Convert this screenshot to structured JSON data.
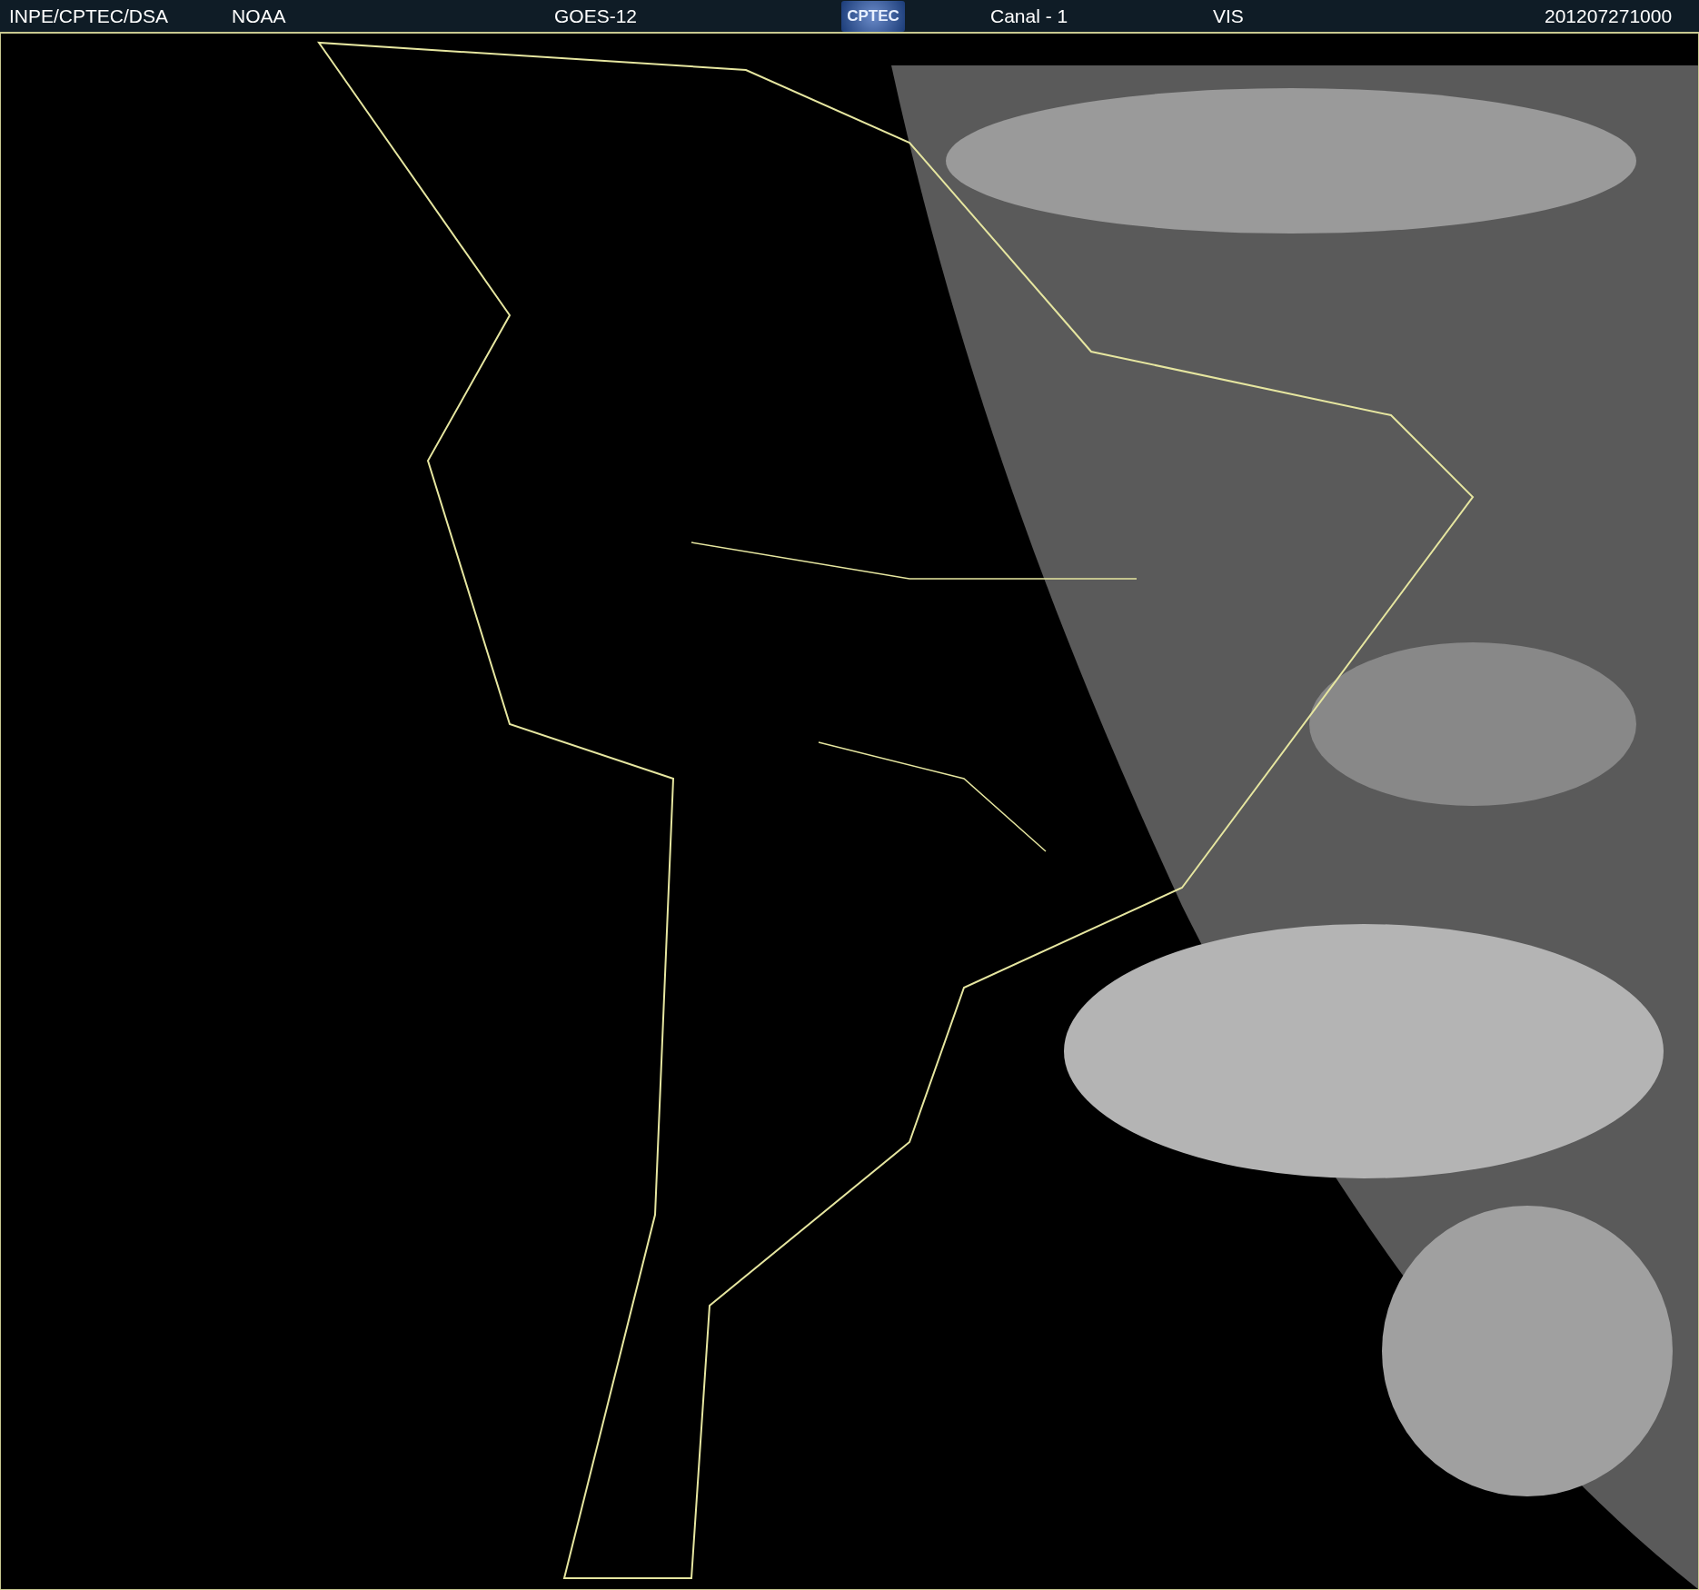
{
  "header": {
    "items": [
      "INPE/CPTEC/DSA",
      "NOAA",
      "GOES-12"
    ],
    "logo": "CPTEC",
    "channel": "Canal - 1",
    "band": "VIS",
    "timestamp": "201207271000"
  }
}
